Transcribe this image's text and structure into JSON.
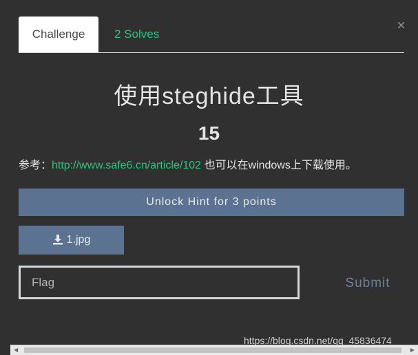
{
  "tabs": {
    "challenge": "Challenge",
    "solves": "2 Solves"
  },
  "close_symbol": "×",
  "challenge": {
    "title": "使用steghide工具",
    "points": "15",
    "desc_prefix": "参考：",
    "desc_link": "http://www.safe6.cn/article/102",
    "desc_suffix": " 也可以在windows上下载使用。"
  },
  "hint_button": "Unlock Hint for 3 points",
  "file": {
    "name": "1.jpg",
    "icon": "download-icon"
  },
  "flag_input": {
    "placeholder": "Flag",
    "value": ""
  },
  "submit_label": "Submit",
  "watermark": "https://blog.csdn.net/qq_45836474",
  "colors": {
    "accent_green": "#2ec27e",
    "button_blue": "#5b7290",
    "background": "#303030"
  }
}
